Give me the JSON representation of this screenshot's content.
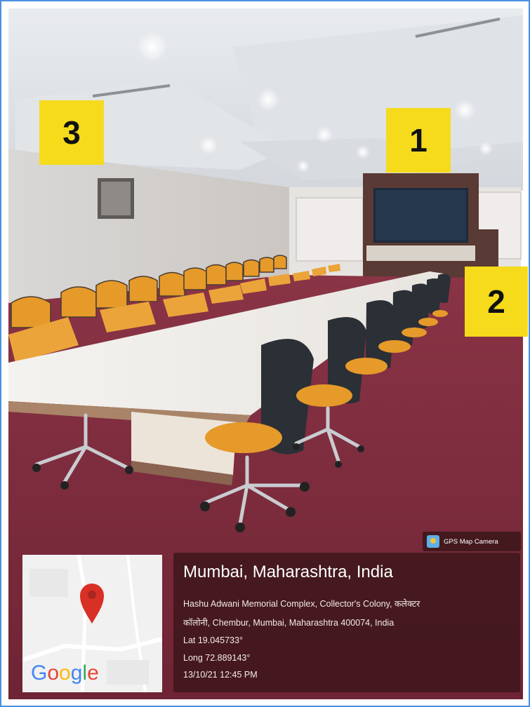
{
  "labels": {
    "one": "1",
    "two": "2",
    "three": "3"
  },
  "gps_badge": {
    "text": "GPS Map Camera",
    "icon": "gps-map-camera-icon"
  },
  "map": {
    "logo_text": "Google",
    "pin_icon": "map-pin-icon"
  },
  "location": {
    "title": "Mumbai, Maharashtra, India",
    "address_line1": "Hashu Adwani Memorial Complex, Collector's Colony, कलेक्टर",
    "address_line2": "कॉलोनी, Chembur, Mumbai, Maharashtra 400074, India",
    "lat": "Lat 19.045733°",
    "long": "Long 72.889143°",
    "datetime": "13/10/21 12:45 PM"
  },
  "colors": {
    "frame_border": "#4a8fe0",
    "label_yellow": "#f5db1c",
    "carpet": "#7a2a3a",
    "chair_orange": "#e59a2a",
    "panel_bg": "#3a161a"
  }
}
